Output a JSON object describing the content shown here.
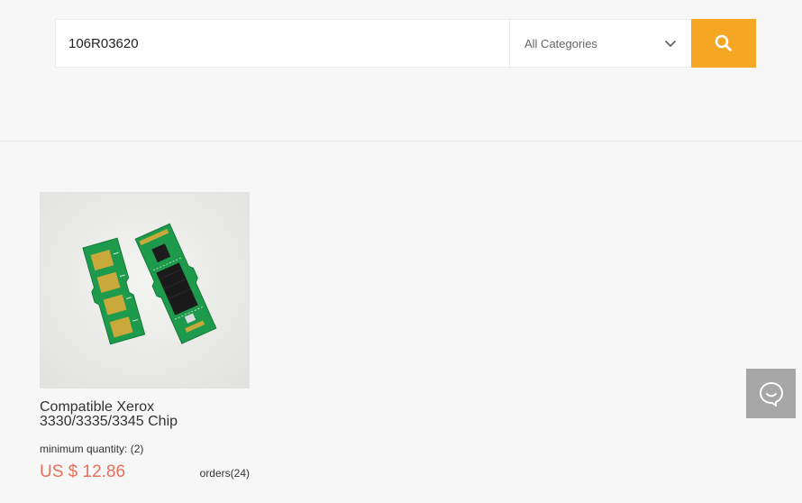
{
  "search": {
    "query": "106R03620",
    "category": "All Categories",
    "button_icon": "search-icon"
  },
  "colors": {
    "accent": "#f5a623",
    "price": "#e8705a",
    "chat_button": "#a6a6a6"
  },
  "product": {
    "title_line1": "Compatible Xerox",
    "title_line2": "3330/3335/3345 Chip",
    "min_quantity_label": "minimum quantity:",
    "min_quantity_value": "(2)",
    "price": "US $ 12.86",
    "orders": "orders(24)"
  },
  "chat": {
    "icon": "chat-bubble-icon"
  }
}
